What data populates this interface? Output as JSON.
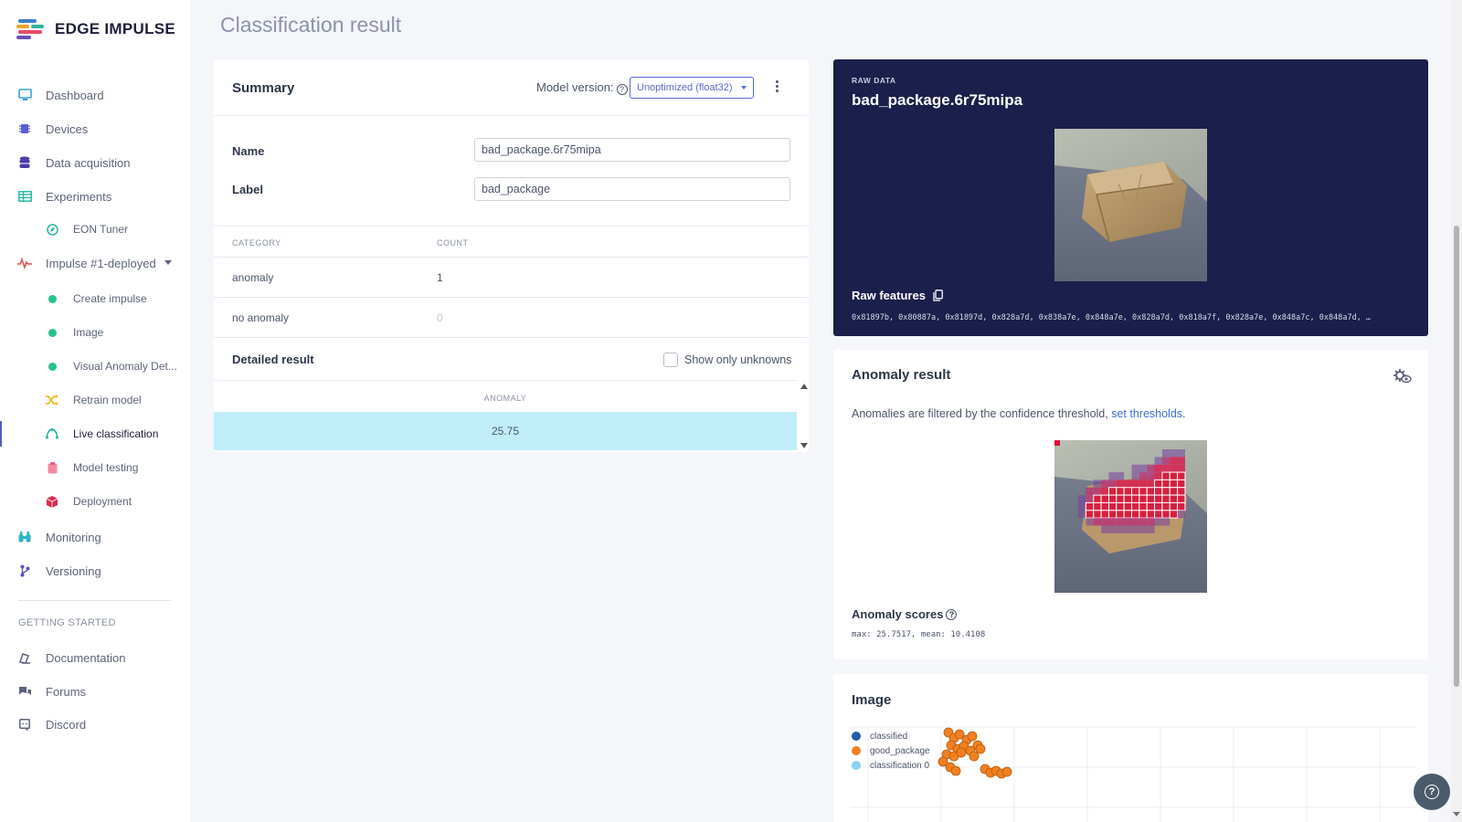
{
  "app": {
    "brand": "EDGE IMPULSE",
    "page_title": "Classification result"
  },
  "sidebar": {
    "items": [
      {
        "label": "Dashboard",
        "icon": "monitor-icon"
      },
      {
        "label": "Devices",
        "icon": "chip-icon"
      },
      {
        "label": "Data acquisition",
        "icon": "database-icon"
      },
      {
        "label": "Experiments",
        "icon": "table-icon"
      },
      {
        "label": "EON Tuner",
        "icon": "compass-icon"
      },
      {
        "label": "Impulse #1-deployed",
        "icon": "pulse-icon"
      },
      {
        "label": "Create impulse",
        "icon": "status-dot-icon"
      },
      {
        "label": "Image",
        "icon": "status-dot-icon"
      },
      {
        "label": "Visual Anomaly Det...",
        "icon": "status-dot-icon"
      },
      {
        "label": "Retrain model",
        "icon": "shuffle-icon"
      },
      {
        "label": "Live classification",
        "icon": "curve-icon"
      },
      {
        "label": "Model testing",
        "icon": "clipboard-icon"
      },
      {
        "label": "Deployment",
        "icon": "cube-icon"
      },
      {
        "label": "Monitoring",
        "icon": "binoculars-icon"
      },
      {
        "label": "Versioning",
        "icon": "branch-icon"
      }
    ],
    "section_heading": "GETTING STARTED",
    "getting_started": [
      {
        "label": "Documentation",
        "icon": "book-icon"
      },
      {
        "label": "Forums",
        "icon": "chat-icon"
      },
      {
        "label": "Discord",
        "icon": "discord-icon"
      }
    ]
  },
  "summary": {
    "title": "Summary",
    "model_version_label": "Model version:",
    "model_version_value": "Unoptimized (float32)",
    "name_label": "Name",
    "name_value": "bad_package.6r75mipa",
    "label_label": "Label",
    "label_value": "bad_package",
    "table_headers": [
      "CATEGORY",
      "COUNT"
    ],
    "rows": [
      {
        "category": "anomaly",
        "count": "1"
      },
      {
        "category": "no anomaly",
        "count": "0"
      }
    ]
  },
  "detailed": {
    "title": "Detailed result",
    "checkbox_label": "Show only unknowns",
    "checkbox_checked": false,
    "column_header": "ANOMALY",
    "row_value": "25.75"
  },
  "raw_data": {
    "kicker": "RAW DATA",
    "title": "bad_package.6r75mipa",
    "features_label": "Raw features",
    "features_values": "0x81897b, 0x80887a, 0x81897d, 0x828a7d, 0x838a7e, 0x848a7e, 0x828a7d, 0x818a7f, 0x828a7e, 0x848a7c, 0x848a7d, …"
  },
  "anomaly": {
    "title": "Anomaly result",
    "description": "Anomalies are filtered by the confidence threshold, ",
    "link_text": "set thresholds",
    "description_end": ".",
    "scores_title": "Anomaly scores",
    "scores_values": "max: 25.7517, mean: 10.4108"
  },
  "image_section": {
    "title": "Image",
    "legend": [
      {
        "label": "classified",
        "color": "#1f5fa8"
      },
      {
        "label": "good_package",
        "color": "#f08020"
      },
      {
        "label": "classification 0",
        "color": "#8ad4f2"
      }
    ]
  },
  "colors": {
    "accent": "#4f5fc7",
    "raw_bg": "#1b1f4b",
    "highlight_row": "#bfeef9",
    "link": "#3b6ec7"
  }
}
